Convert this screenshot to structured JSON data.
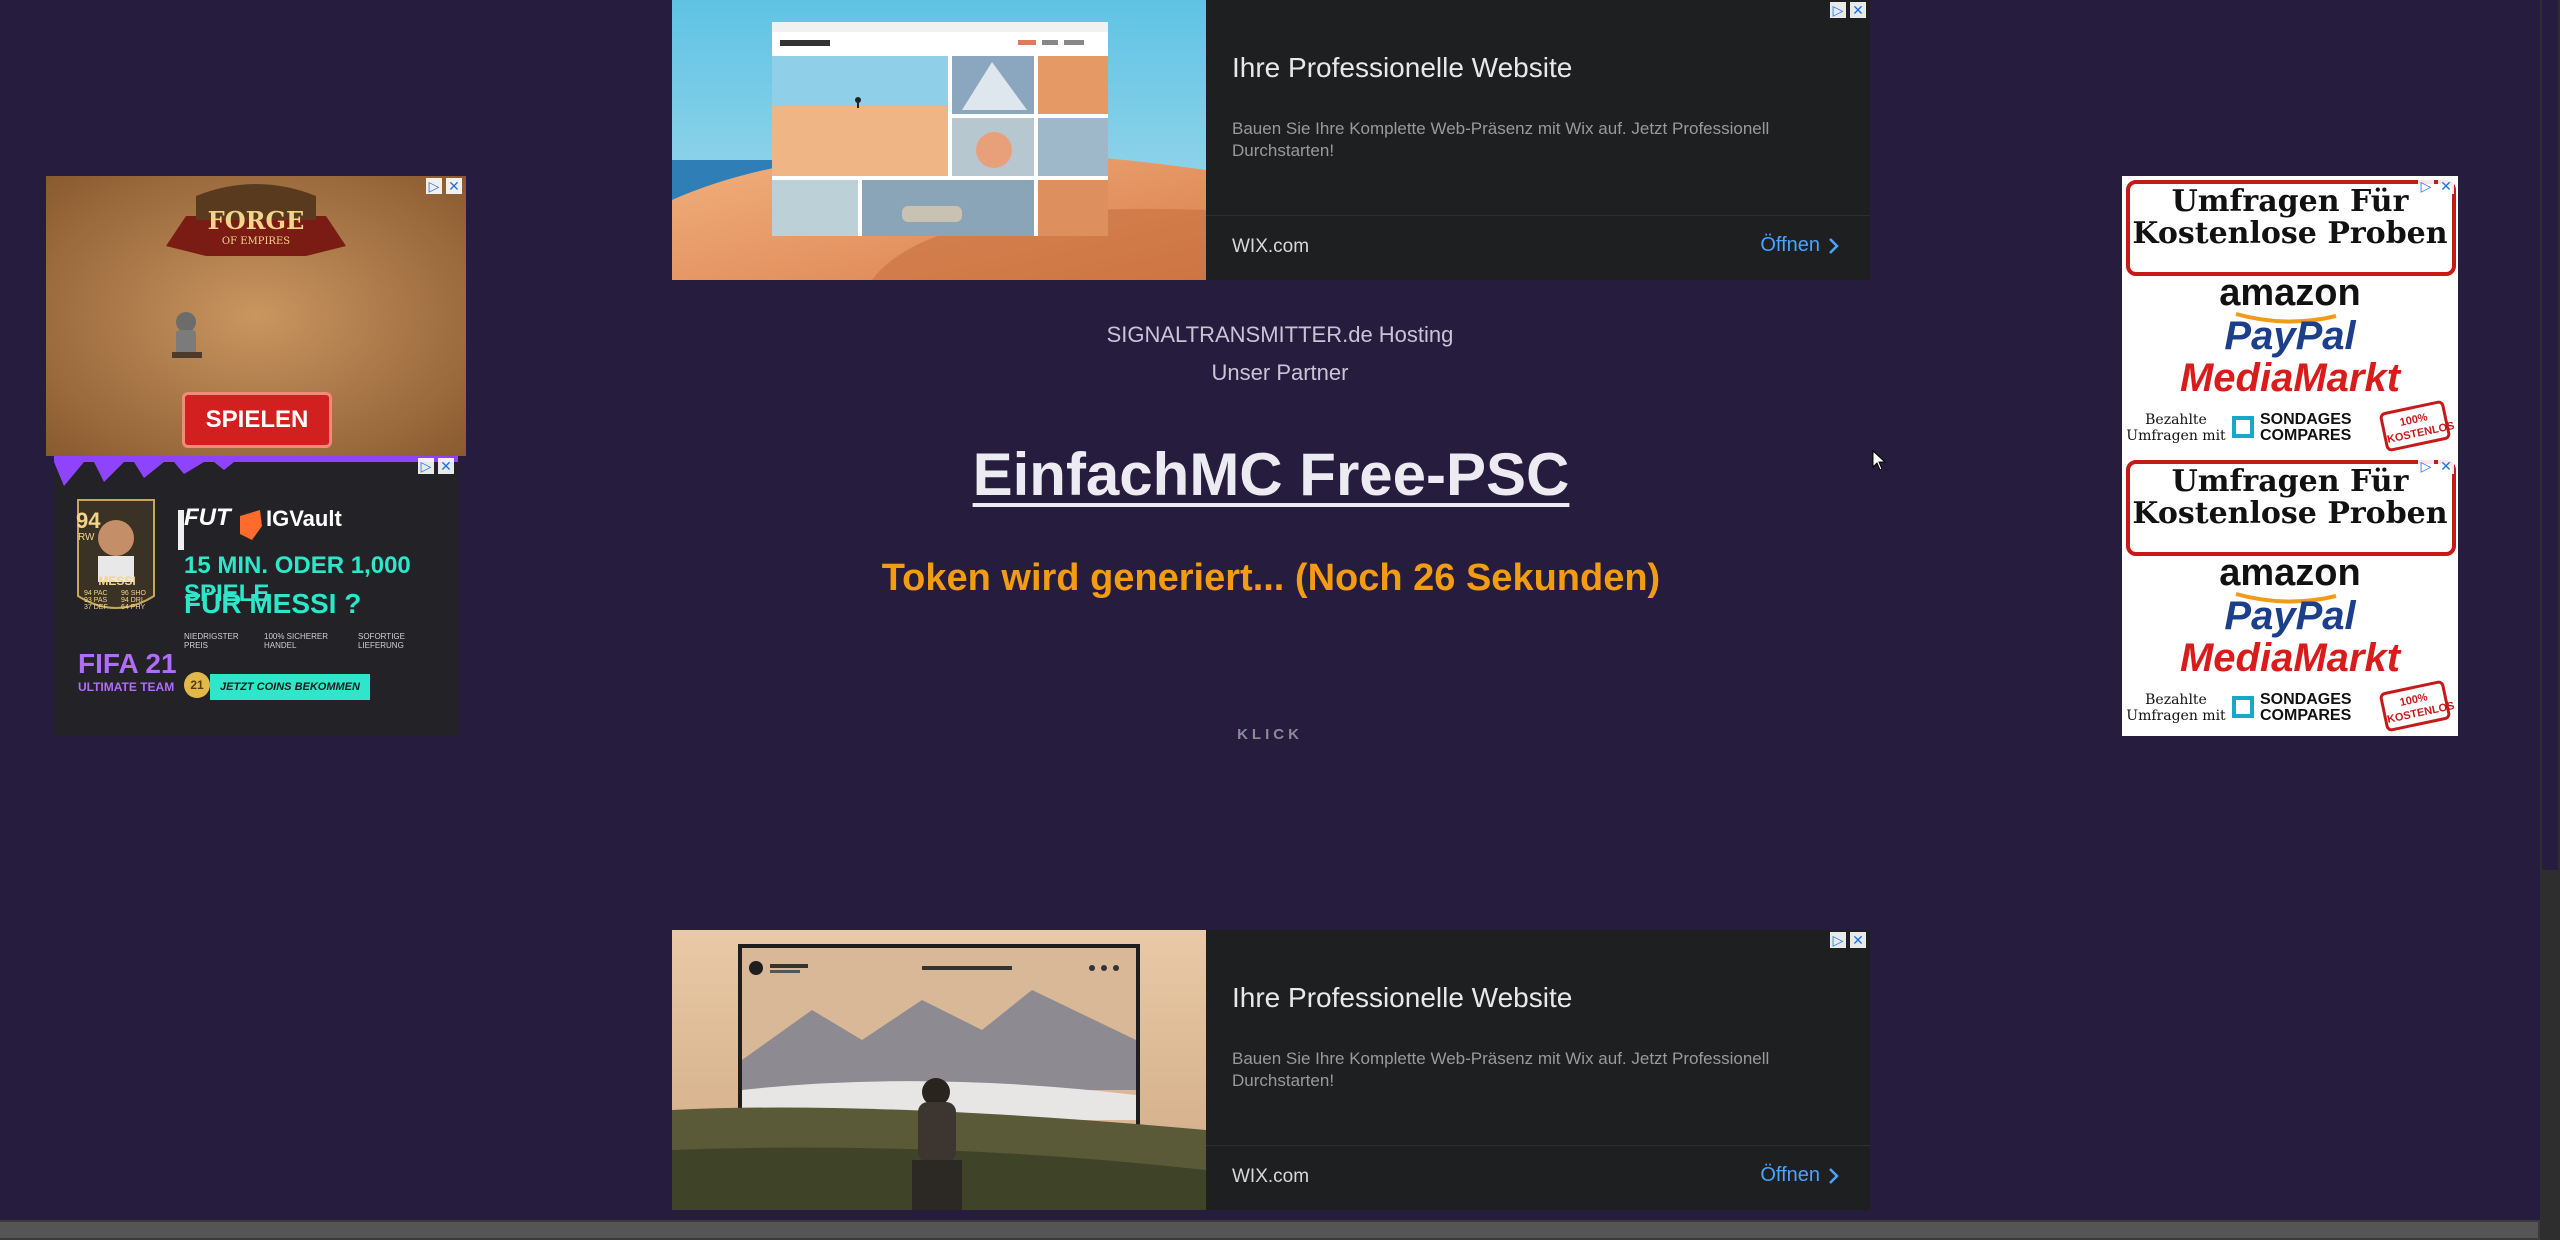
{
  "ad_top": {
    "title": "Ihre Professionelle Website",
    "description": "Bauen Sie Ihre Komplette Web-Präsenz mit Wix auf. Jetzt Professionell Durchstarten!",
    "domain": "WIX.com",
    "cta": "Öffnen",
    "mock_brand": "ALAN PHOTOGRAPHY",
    "mock_nav": [
      "Portfolio",
      "About",
      "Contact"
    ]
  },
  "ad_bottom": {
    "title": "Ihre Professionelle Website",
    "description": "Bauen Sie Ihre Komplette Web-Präsenz mit Wix auf. Jetzt Professionell Durchstarten!",
    "domain": "WIX.com",
    "cta": "Öffnen",
    "mock_brand": "AMANDA LIN PHOTOGRAPHY",
    "mock_nav": [
      "HOME",
      "GALLERY",
      "SHOP",
      "ABOUT",
      "CONTACT"
    ]
  },
  "partner": {
    "image_alt": "SIGNALTRANSMITTER.de Hosting",
    "label": "Unser Partner"
  },
  "page": {
    "heading": "EinfachMC Free-PSC",
    "token_status": "Token wird generiert... (Noch 26 Sekunden)",
    "klick": "KLICK"
  },
  "ad_forge": {
    "logo_line1": "FORGE",
    "logo_line2": "OF EMPIRES",
    "button": "SPIELEN"
  },
  "ad_fifa": {
    "brand1": "FUT",
    "brand2": "IGVault",
    "headline1": "15 MIN. ODER 1,000 SPIELE",
    "headline2": "FÜR MESSI ?",
    "card_rating": "94",
    "card_pos": "RW",
    "card_name": "MESSI",
    "stats": [
      "94 PAC",
      "96 SHO",
      "93 PAS",
      "94 DRI",
      "37 DEF",
      "64 PHY"
    ],
    "features": [
      "NIEDRIGSTER PREIS",
      "100% SICHERER HANDEL",
      "SOFORTIGE LIEFERUNG"
    ],
    "game": "FIFA 21",
    "game_sub": "ULTIMATE TEAM",
    "cta": "JETZT COINS BEKOMMEN",
    "coin": "21"
  },
  "ad_right": [
    {
      "title_line1": "Umfragen Für",
      "title_line2": "Kostenlose Proben",
      "brand1": "amazon",
      "brand2": "PayPal",
      "brand3": "MediaMarkt",
      "footer_line1": "Bezahlte",
      "footer_line2": "Umfragen mit",
      "footer_brand_line1": "SONDAGES",
      "footer_brand_line2": "COMPARES",
      "stamp_line1": "100%",
      "stamp_line2": "KOSTENLOS"
    },
    {
      "title_line1": "Umfragen Für",
      "title_line2": "Kostenlose Proben",
      "brand1": "amazon",
      "brand2": "PayPal",
      "brand3": "MediaMarkt",
      "footer_line1": "Bezahlte",
      "footer_line2": "Umfragen mit",
      "footer_brand_line1": "SONDAGES",
      "footer_brand_line2": "COMPARES",
      "stamp_line1": "100%",
      "stamp_line2": "KOSTENLOS"
    }
  ],
  "colors": {
    "page_background": "#261c3e",
    "heading": "#ecebf2",
    "token_status": "#f39c12",
    "wix_cta": "#4aa3ff",
    "spielen_button": "#d21f1f"
  }
}
